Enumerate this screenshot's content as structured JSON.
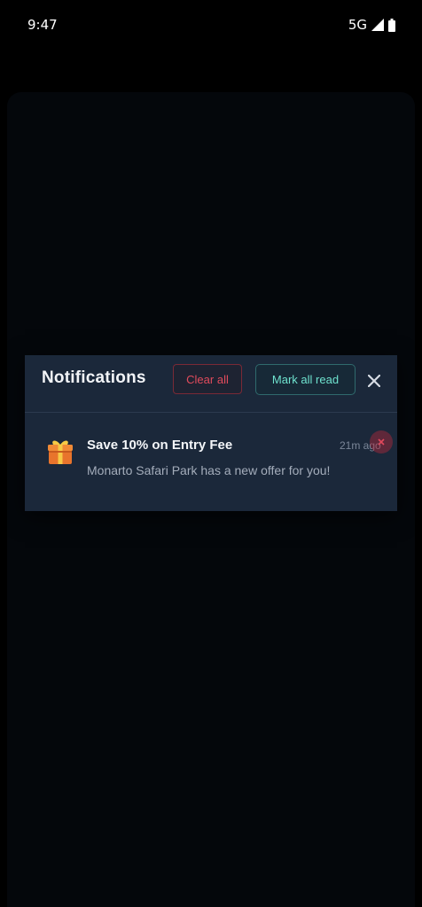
{
  "status_bar": {
    "time": "9:47",
    "network": "5G",
    "icons": [
      "signal-icon",
      "battery-icon"
    ]
  },
  "notifications": {
    "title": "Notifications",
    "clear_all_label": "Clear all",
    "mark_all_read_label": "Mark all read",
    "close_icon": "close-icon",
    "colors": {
      "panel_bg": "#1b283a",
      "clear_all": "#e14b5c",
      "mark_all_read": "#6fe3cf"
    },
    "items": [
      {
        "icon": "gift-icon",
        "title": "Save 10% on Entry Fee",
        "body": "Monarto Safari Park has a new offer for you!",
        "time": "21m ago"
      }
    ]
  }
}
